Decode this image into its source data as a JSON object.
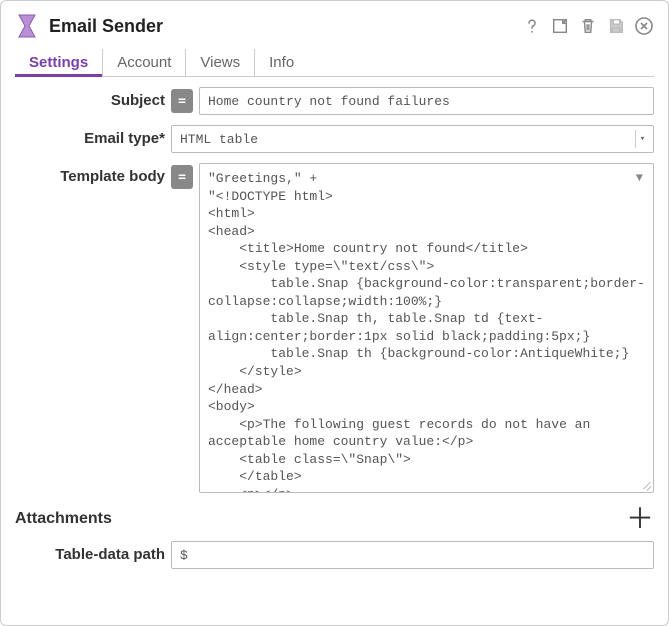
{
  "header": {
    "title": "Email Sender"
  },
  "tabs": [
    {
      "label": "Settings",
      "active": true
    },
    {
      "label": "Account",
      "active": false
    },
    {
      "label": "Views",
      "active": false
    },
    {
      "label": "Info",
      "active": false
    }
  ],
  "form": {
    "subject": {
      "label": "Subject",
      "value": "Home country not found failures",
      "eq": "="
    },
    "email_type": {
      "label": "Email type*",
      "value": "HTML table"
    },
    "template_body": {
      "label": "Template body",
      "eq": "=",
      "value": "\"Greetings,\" +\n\"<!DOCTYPE html>\n<html>\n<head>\n    <title>Home country not found</title>\n    <style type=\\\"text/css\\\">\n        table.Snap {background-color:transparent;border-collapse:collapse;width:100%;}\n        table.Snap th, table.Snap td {text-align:center;border:1px solid black;padding:5px;}\n        table.Snap th {background-color:AntiqueWhite;}\n    </style>\n</head>\n<body>\n    <p>The following guest records do not have an acceptable home country value:</p>\n    <table class=\\\"Snap\\\">\n    </table>\n    <p></p>\n    <p>Regards,</p>\n    <p>Roger</p>\n</body>\n</html>\""
    },
    "table_data_path": {
      "label": "Table-data path",
      "value": "$"
    }
  },
  "attachments": {
    "title": "Attachments"
  }
}
